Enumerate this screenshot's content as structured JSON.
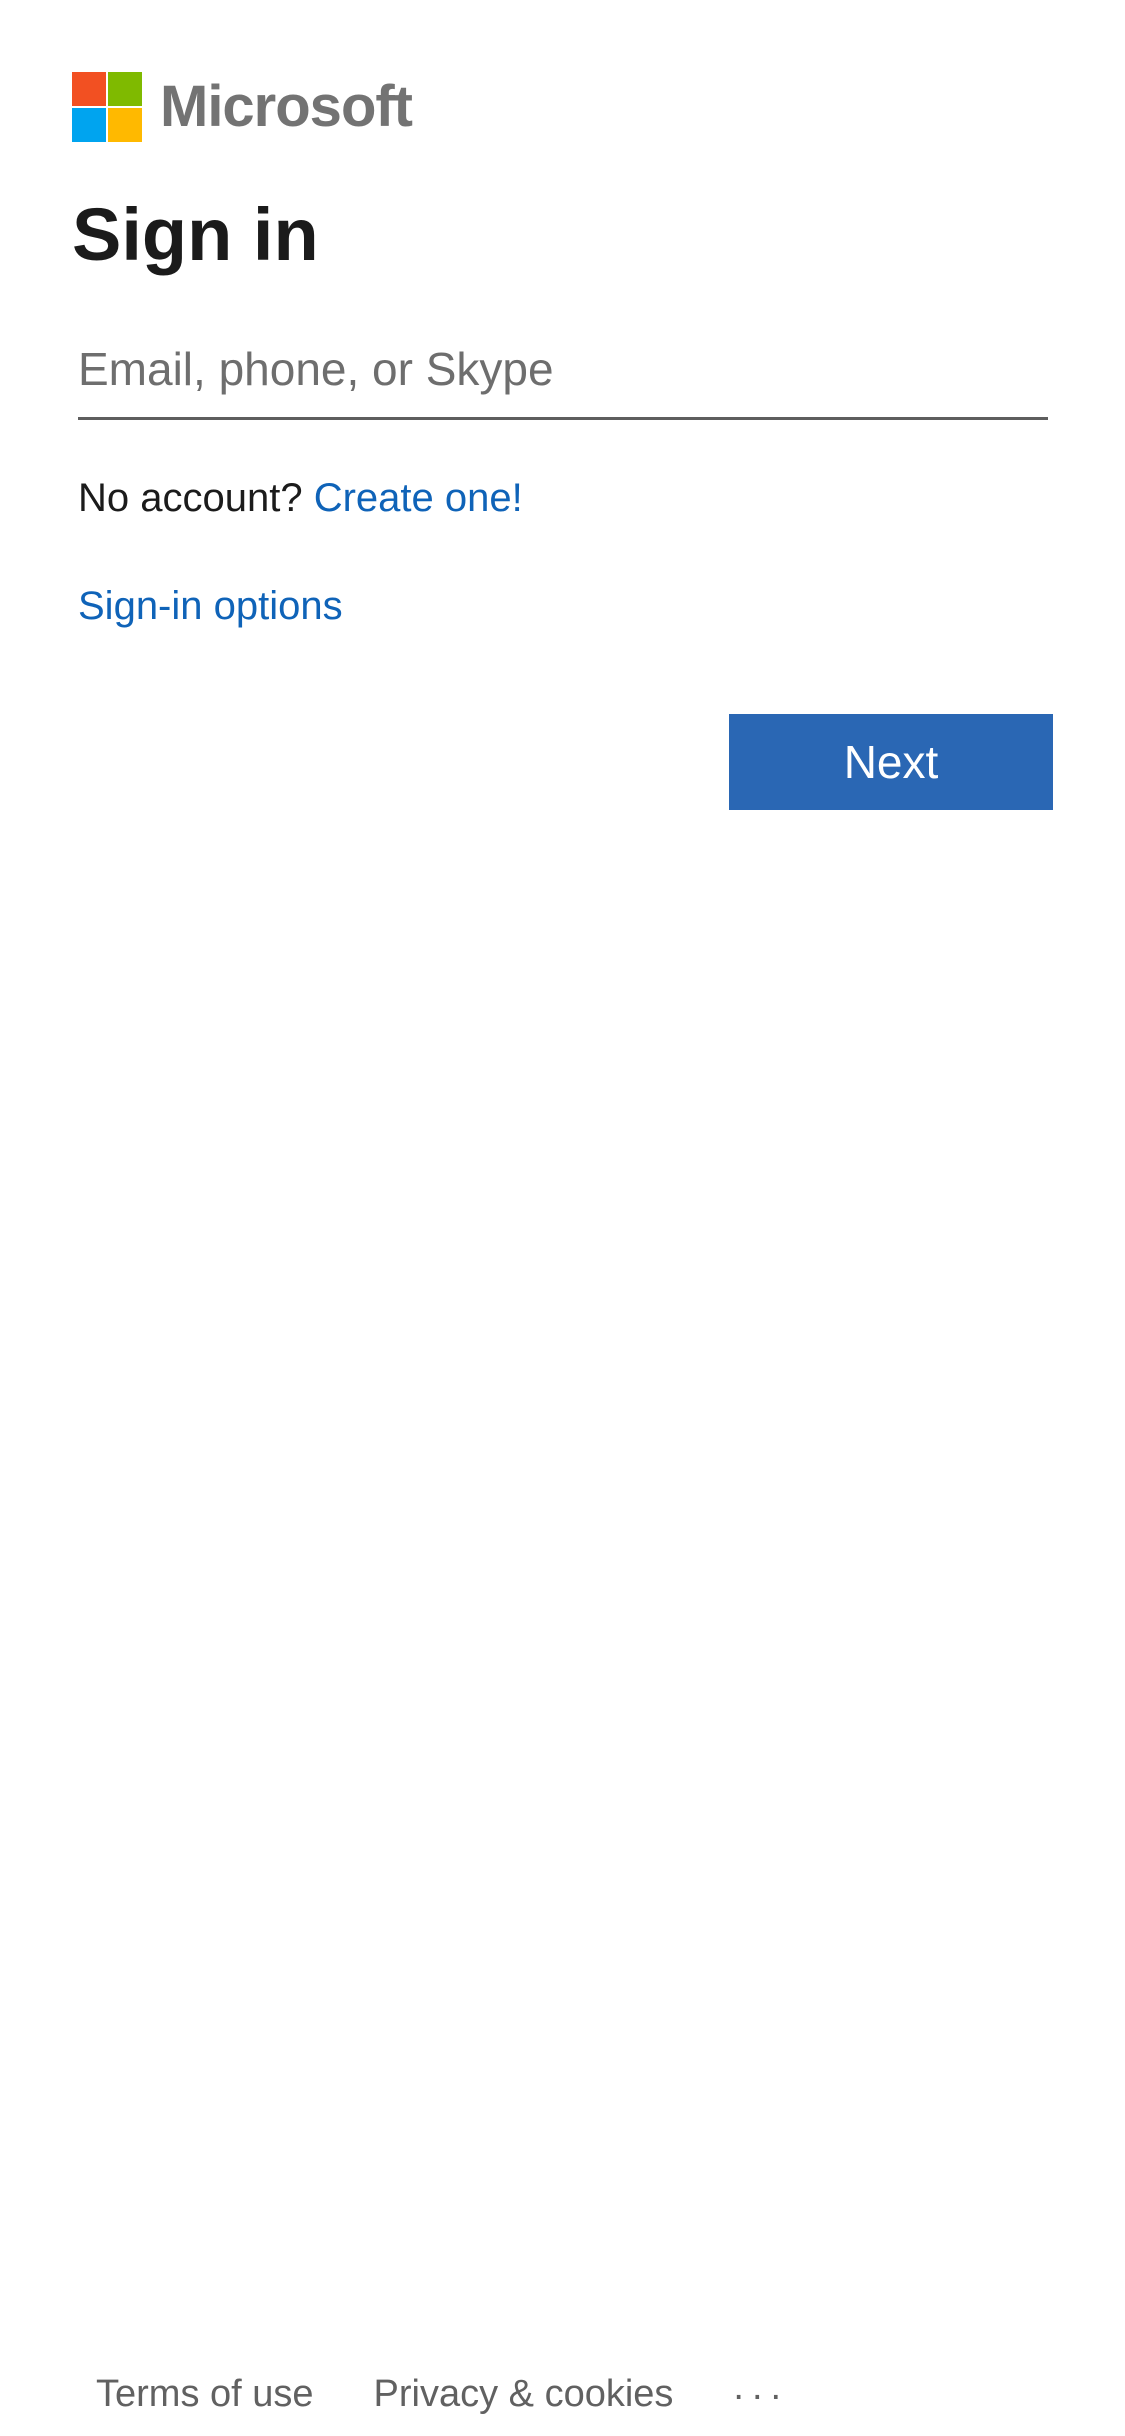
{
  "brand": {
    "name": "Microsoft",
    "colors": {
      "red": "#f25022",
      "green": "#7fba00",
      "blue": "#00a4ef",
      "yellow": "#ffb900",
      "accent": "#2a67b4"
    }
  },
  "title": "Sign in",
  "email_input": {
    "placeholder": "Email, phone, or Skype",
    "value": ""
  },
  "no_account": {
    "text": "No account?",
    "link": "Create one!"
  },
  "signin_options_link": "Sign-in options",
  "next_button_label": "Next",
  "footer": {
    "terms": "Terms of use",
    "privacy": "Privacy & cookies",
    "more": "..."
  },
  "icons": {
    "logo": "microsoft-logo-icon",
    "more": "ellipsis-icon"
  }
}
